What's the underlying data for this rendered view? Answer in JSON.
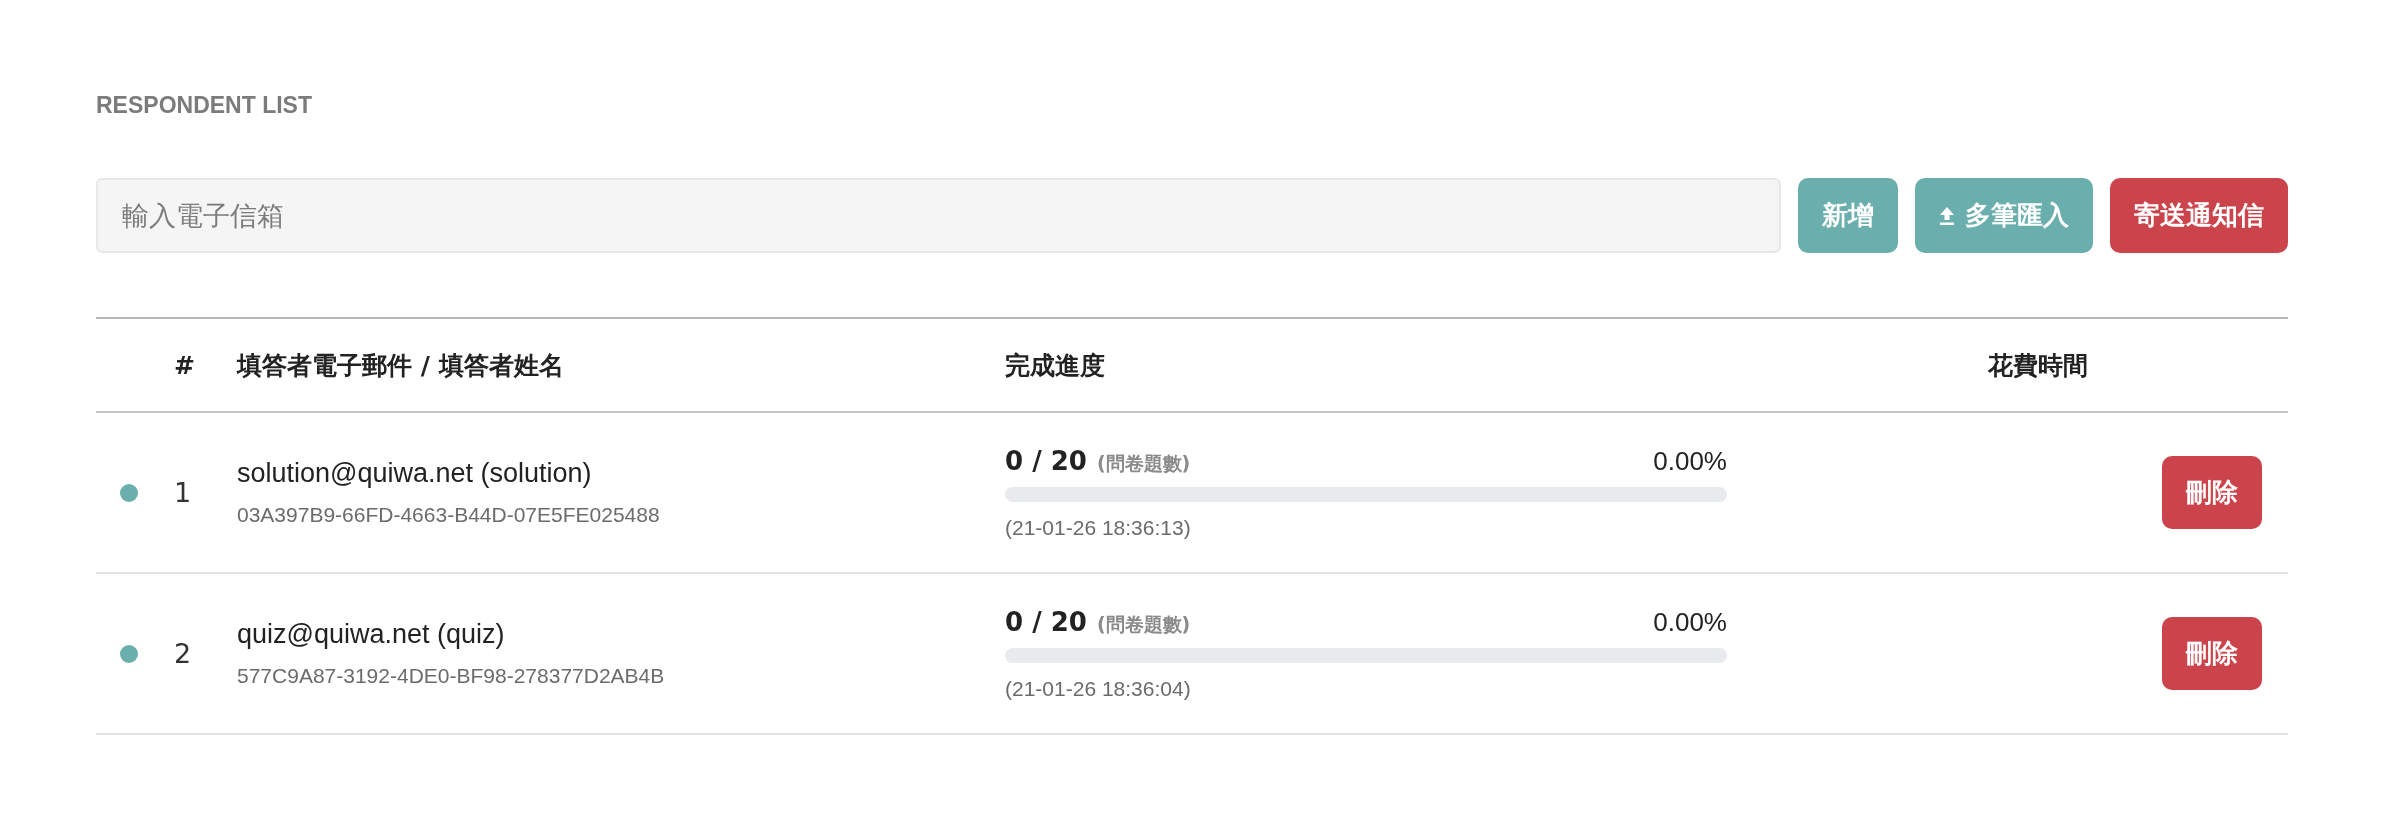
{
  "section_title": "RESPONDENT LIST",
  "email_field": {
    "placeholder": "輸入電子信箱"
  },
  "buttons": [
    {
      "label": "新增",
      "kind": "add"
    },
    {
      "label": "多筆匯入",
      "kind": "import"
    },
    {
      "label": "寄送通知信",
      "kind": "notify"
    }
  ],
  "table": {
    "columns": [
      "#",
      "填答者電子郵件 / 填答者姓名",
      "完成進度",
      "花費時間"
    ],
    "rows": [
      {
        "color": "#6aafad",
        "number": "1",
        "email": "solution@quiwa.net (solution)",
        "id": "03A397B9-66FD-4663-B44D-07E5FE025488",
        "count": "0 / 20",
        "count_note": "(問卷題數)",
        "percent": "0.00%",
        "level": 0,
        "time": "(21-01-26 18:36:13)",
        "delete": "刪除"
      },
      {
        "color": "#6aafad",
        "number": "2",
        "email": "quiz@quiwa.net (quiz)",
        "id": "577C9A87-3192-4DE0-BF98-278377D2AB4B",
        "count": "0 / 20",
        "count_note": "(問卷題數)",
        "percent": "0.00%",
        "level": 0,
        "time": "(21-01-26 18:36:04)",
        "delete": "刪除"
      }
    ]
  }
}
